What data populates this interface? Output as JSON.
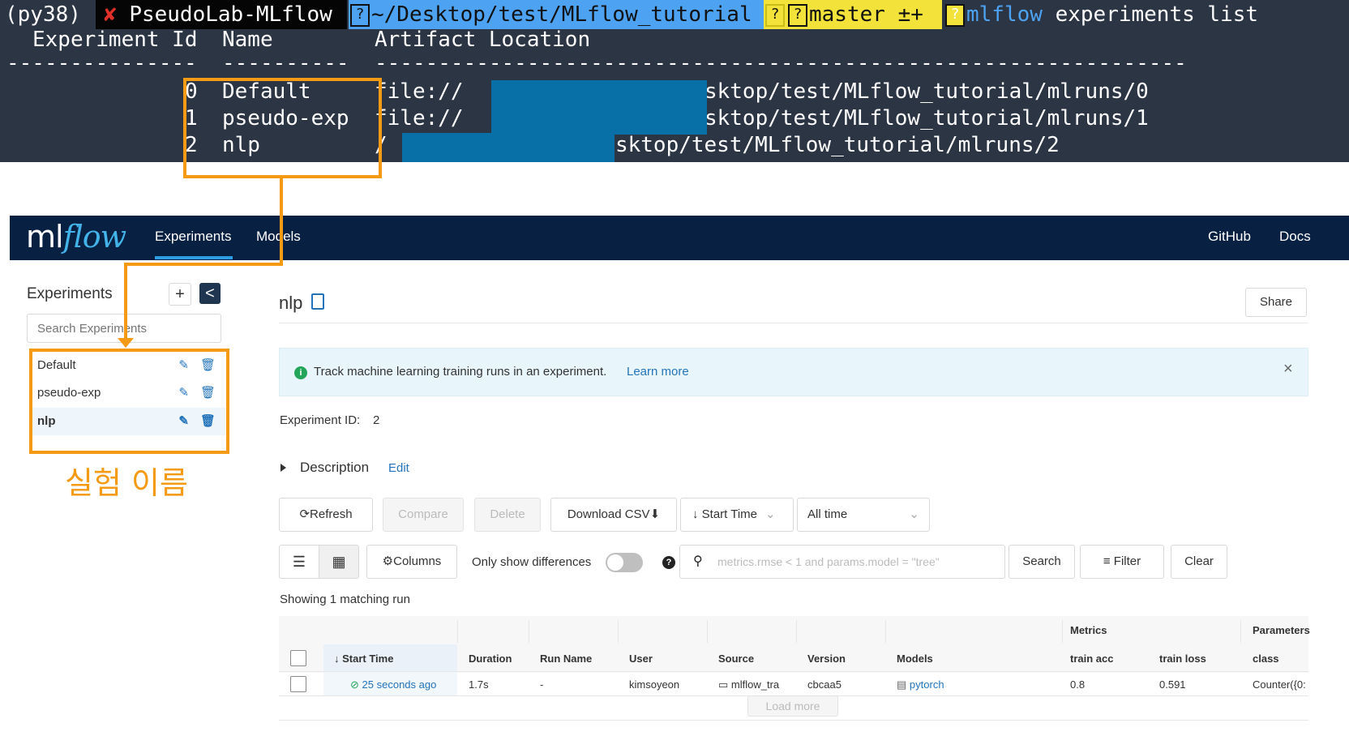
{
  "terminal": {
    "prompt": {
      "env": "(py38)",
      "status": "✘",
      "user": "PseudoLab-MLflow",
      "path": "~/Desktop/test/MLflow_tutorial",
      "branch": "master ±+",
      "command_name": "mlflow",
      "command_args": " experiments list",
      "unknown_glyph": "?"
    },
    "columns": [
      "Experiment Id",
      "Name",
      "Artifact Location"
    ],
    "separator_id": "---------------",
    "separator_name": "----------",
    "separator_loc": "----------------------------------------------------------------",
    "rows": [
      {
        "id": "0",
        "name": "Default",
        "loc_prefix": "file://",
        "loc_suffix": "/Desktop/test/MLflow_tutorial/mlruns/0"
      },
      {
        "id": "1",
        "name": "pseudo-exp",
        "loc_prefix": "file://",
        "loc_suffix": "/Desktop/test/MLflow_tutorial/mlruns/1"
      },
      {
        "id": "2",
        "name": "nlp",
        "loc_prefix": "/",
        "loc_suffix": "/Desktop/test/MLflow_tutorial/mlruns/2"
      }
    ]
  },
  "header": {
    "logo_ml": "ml",
    "logo_flow": "flow",
    "nav": [
      "Experiments",
      "Models"
    ],
    "right_links": [
      "GitHub",
      "Docs"
    ]
  },
  "sidebar": {
    "title": "Experiments",
    "add_label": "+",
    "collapse_label": "<",
    "search_placeholder": "Search Experiments",
    "experiments": [
      "Default",
      "pseudo-exp",
      "nlp"
    ],
    "selected": "nlp",
    "edit_icon": "✎",
    "delete_icon": "🗑"
  },
  "annotation": {
    "label": "실험 이름",
    "color": "#f59a14"
  },
  "main": {
    "title": "nlp",
    "share_label": "Share",
    "info_text": "Track machine learning training runs in an experiment.",
    "info_link": "Learn more",
    "close_label": "×",
    "experiment_id_label": "Experiment ID:",
    "experiment_id_value": "2",
    "description_label": "Description",
    "description_edit": "Edit",
    "toolbar": {
      "refresh": "Refresh",
      "compare": "Compare",
      "delete": "Delete",
      "download_csv": "Download CSV",
      "sort": "Start Time",
      "time_range": "All time"
    },
    "toolbar2": {
      "columns": "Columns",
      "only_diff": "Only show differences",
      "help": "?",
      "search_placeholder": "metrics.rmse < 1 and params.model = \"tree\"",
      "search": "Search",
      "filter": "Filter",
      "clear": "Clear"
    },
    "showing_text": "Showing 1 matching run",
    "table": {
      "group_headers": {
        "metrics": "Metrics",
        "parameters": "Parameters"
      },
      "columns": [
        "Start Time",
        "Duration",
        "Run Name",
        "User",
        "Source",
        "Version",
        "Models",
        "train acc",
        "train loss",
        "class"
      ],
      "row": {
        "start_time": "25 seconds ago",
        "duration": "1.7s",
        "run_name": "-",
        "user": "kimsoyeon",
        "source": "mlflow_tra",
        "version": "cbcaa5",
        "models": "pytorch",
        "train_acc": "0.8",
        "train_loss": "0.591",
        "class": "Counter({0:"
      },
      "load_more": "Load more"
    }
  },
  "colors": {
    "terminal_bg": "#2c3544",
    "header_bg": "#082042",
    "accent_blue": "#2374bb",
    "info_bg": "#e8f6fb",
    "redaction": "#0870a6"
  }
}
